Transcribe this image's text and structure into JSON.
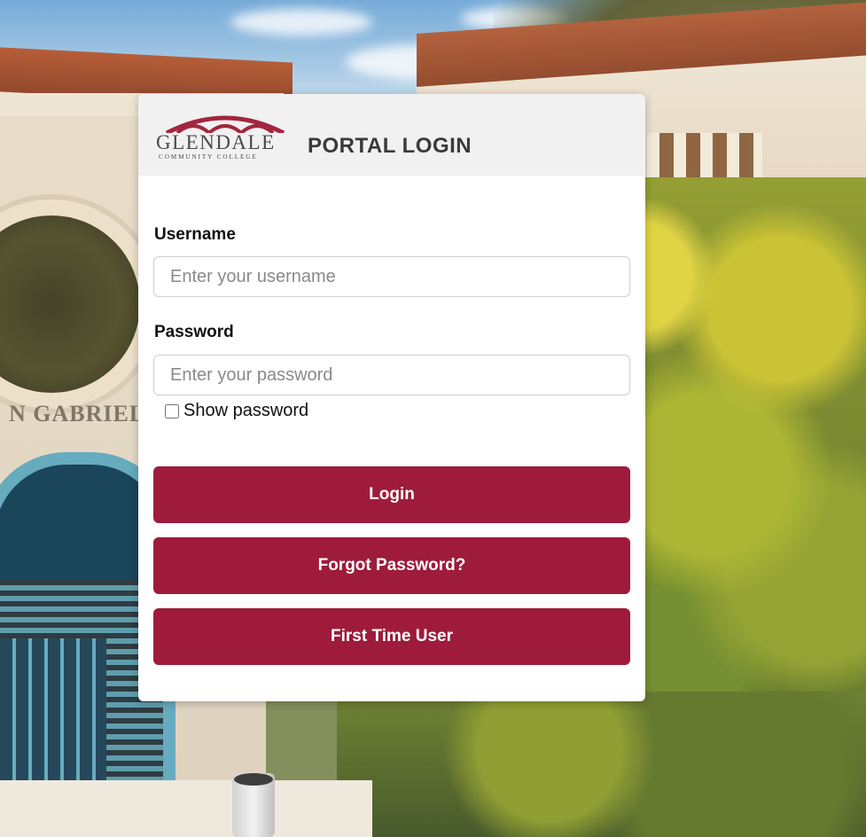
{
  "header": {
    "logo_wordmark": "GLENDALE",
    "logo_subtitle": "COMMUNITY COLLEGE",
    "title": "PORTAL LOGIN"
  },
  "background": {
    "carved_text": "N GABRIEL"
  },
  "form": {
    "username_label": "Username",
    "username_placeholder": "Enter your username",
    "username_value": "",
    "password_label": "Password",
    "password_placeholder": "Enter your password",
    "password_value": "",
    "show_password_label": "Show password",
    "show_password_checked": false
  },
  "buttons": {
    "login": "Login",
    "forgot_password": "Forgot Password?",
    "first_time_user": "First Time User"
  },
  "colors": {
    "button_bg": "#9e1b3b",
    "logo_arc": "#a3263e",
    "header_bg": "#f1f1f1"
  },
  "icons": {
    "logo": "glendale-arches-logo"
  }
}
